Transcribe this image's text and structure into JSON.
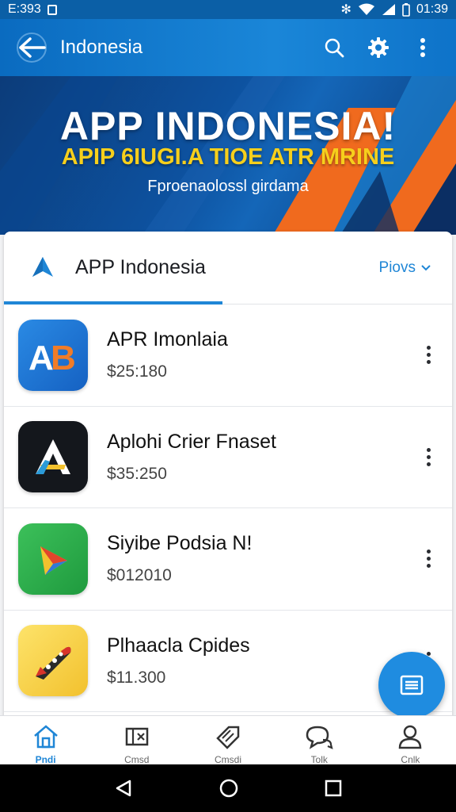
{
  "status_bar": {
    "time_left": "E:393",
    "time_right": "01:39"
  },
  "app_bar": {
    "title": "Indonesia",
    "icons": [
      "back-arrow-icon",
      "search-icon",
      "gear-icon",
      "more-vert-icon"
    ]
  },
  "banner": {
    "headline": "APP INDONESIA!",
    "subheadline": "APIP 6IUGI.A TIOE ATR MRINE",
    "tagline": "Fproenaolossl girdama"
  },
  "list_card": {
    "title": "APP Indonesia",
    "more_label": "Piovs",
    "apps": [
      {
        "name": "APR Imonlaia",
        "price": "$25:180",
        "icon": "ab-app-icon"
      },
      {
        "name": "Aplohi Crier Fnaset",
        "price": "$35:250",
        "icon": "a-app-icon"
      },
      {
        "name": "Siyibe Podsia N!",
        "price": "$012010",
        "icon": "play-triangle-app-icon"
      },
      {
        "name": "Plhaacla Cpides",
        "price": "$11.300",
        "icon": "rocket-app-icon"
      }
    ]
  },
  "bottom_nav": {
    "items": [
      {
        "label": "Pndi",
        "icon": "home-icon",
        "active": true
      },
      {
        "label": "Cmsd",
        "icon": "ticket-icon",
        "active": false
      },
      {
        "label": "Cmsdi",
        "icon": "tag-icon",
        "active": false
      },
      {
        "label": "Tolk",
        "icon": "chat-icon",
        "active": false
      },
      {
        "label": "Cnlk",
        "icon": "person-icon",
        "active": false
      }
    ]
  },
  "colors": {
    "accent": "#1f86d6",
    "app_bar": "#0a6bc0",
    "banner_orange": "#f06a1e",
    "banner_yellow": "#f6cf1c"
  }
}
